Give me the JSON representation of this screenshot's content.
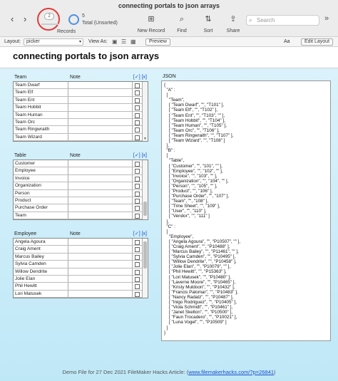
{
  "window": {
    "title": "connecting portals to json arrays"
  },
  "toolbar": {
    "back": "‹",
    "forward": "›",
    "record_current": "2",
    "records_label": "Records",
    "found_count": "5",
    "found_status": "Total (Unsorted)",
    "new_record_label": "New Record",
    "find_label": "Find",
    "sort_label": "Sort",
    "share_label": "Share",
    "search_placeholder": "Search",
    "more": "»"
  },
  "layoutbar": {
    "layout_label": "Layout:",
    "layout_value": "picker",
    "view_as_label": "View As:",
    "preview_label": "Preview",
    "aa_label": "Aa",
    "edit_layout_label": "Edit Layout"
  },
  "page": {
    "title": "connecting portals to json arrays"
  },
  "portals": {
    "team": {
      "col1": "Team",
      "col2": "Note",
      "actions": "[✓] [x]",
      "rows": [
        "Team Dwarf",
        "Team Elf",
        "Team Ent",
        "Team Hobbit",
        "Team Human",
        "Team Orc",
        "Team Ringwraith",
        "Team Wizard"
      ]
    },
    "table": {
      "col1": "Table",
      "col2": "Note",
      "actions": "[✓] [x]",
      "rows": [
        "Customer",
        "Employee",
        "Invoice",
        "Organization",
        "Person",
        "Product",
        "Purchase Order",
        "Team"
      ]
    },
    "employee": {
      "col1": "Employee",
      "col2": "Note",
      "actions": "[✓] [x]",
      "rows": [
        "Angela Agoura",
        "Craig Ament",
        "Marcus Bailey",
        "Sylvia Camden",
        "Willow Dendrite",
        "Jolie Elan",
        "Phil Hewitt",
        "Lori Matusek"
      ]
    }
  },
  "json": {
    "label": "JSON",
    "text": "{\n  \"A\" :\n  [\n    \"Team\",\n    [ \"Team Dwarf\", \"\", \"T101\" ],\n    [ \"Team Elf\", \"\", \"T102\" ],\n    [ \"Team Ent\", \"\", \"T103\", \"\" ],\n    [ \"Team Hobbit\", \"\", \"T104\" ],\n    [ \"Team Human\", \"\", \"T105\" ],\n    [ \"Team Orc\", \"\", \"T106\" ],\n    [ \"Team Ringwraith\", \"\", \"T107\" ],\n    [ \"Team Wizard\", \"\", \"T108\" ]\n  ],\n  \"B\" :\n  [\n    \"Table\",\n    [ \"Customer\", \"\", \"101\", \"\" ],\n    [ \"Employee\", \"\", \"102\", \"\" ],\n    [ \"Invoice\", \"\", \"103\", \"\" ],\n    [ \"Organization\", \"\", \"104\", \"\" ],\n    [ \"Person\", \"\", \"105\", \"\" ],\n    [ \"Product\", \"\", \"106\" ],\n    [ \"Purchase Order\", \"\", \"107\" ],\n    [ \"Team\", \"\", \"108\" ],\n    [ \"Time Sheet\", \"\", \"109\" ],\n    [ \"User\", \"\", \"110\" ],\n    [ \"Vendor\", \"\", \"111\" ]\n  ],\n  \"C\" :\n  [\n    \"Employee\",\n    [ \"Angela Agoura\", \"\", \"P10507\", \"\" ],\n    [ \"Craig Ament\", \"\", \"P10488\" ],\n    [ \"Marcus Bailey\", \"\", \"P11461\", \"\" ],\n    [ \"Sylvia Camden\", \"\", \"P10495\" ],\n    [ \"Willow Dendrite\", \"\", \"P10458\" ],\n    [ \"Jolie Elan\", \"\", \"P10079\", \"\" ],\n    [ \"Phil Hewitt\", \"\", \"P15363\" ],\n    [ \"Lori Matusek\", \"\", \"P10480\" ],\n    [ \"Laverne Moore\", \"\", \"P10465\" ],\n    [ \"Kristy Muldoon\", \"\", \"P10432\" ],\n    [ \"Francis Palomar\", \"\", \"P10483\" ],\n    [ \"Nancy Radatz\", \"\", \"P10487\" ],\n    [ \"Inigo Rodriguez\", \"\", \"P10405\" ],\n    [ \"Viola Schmidt\", \"\", \"P10461\" ],\n    [ \"Janet Skelton\", \"\", \"P10500\" ],\n    [ \"Faun Trocadero\", \"\", \"P10021\" ],\n    [ \"Luna Vogel\", \"\", \"P10509\" ]\n  ]\n}"
  },
  "footer": {
    "text": "Demo File for 27 Dec 2021 FileMaker Hacks Article: (",
    "link": "www.filemakerhacks.com/?p=26841",
    "close": ")"
  },
  "colors": {
    "accent_circle": "#e23b3b",
    "link": "#1a4dcc",
    "background_gradient_top": "#dcf3fb",
    "background_gradient_bottom": "#bfe8f7"
  }
}
